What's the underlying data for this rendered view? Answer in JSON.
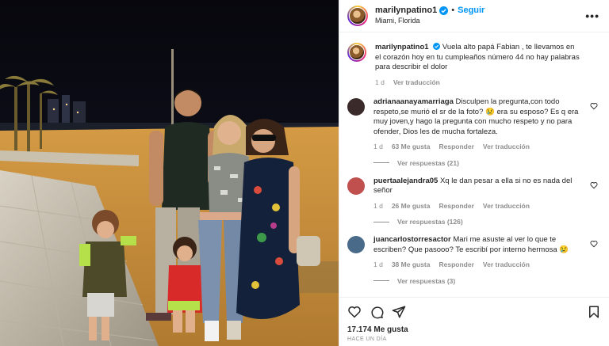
{
  "post": {
    "username": "marilynpatino1",
    "follow_label": "Seguir",
    "separator": "•",
    "location": "Miami, Florida",
    "more_icon": "more-options-icon",
    "caption": {
      "username": "marilynpatino1",
      "text": "Vuela alto papá Fabian , te llevamos en el corazón hoy en tu cumpleaños número 44 no hay palabras para describir el dolor",
      "time": "1 d",
      "translate": "Ver traducción"
    }
  },
  "comments": [
    {
      "username": "adrianaanayamarriaga",
      "text": "Disculpen la pregunta,con todo respeto,se murió el sr de la foto? 😢 era su esposo? Es q era muy joven,y hago la pregunta con mucho respeto y no para ofender, Dios les de mucha fortaleza.",
      "time": "1 d",
      "likes": "63 Me gusta",
      "reply": "Responder",
      "translate": "Ver traducción",
      "replies": "Ver respuestas (21)",
      "avatar_color": "#3b2a2a"
    },
    {
      "username": "puertaalejandra05",
      "text": "Xq le dan pesar a ella si no es nada del señor",
      "time": "1 d",
      "likes": "26 Me gusta",
      "reply": "Responder",
      "translate": "Ver traducción",
      "replies": "Ver respuestas (126)",
      "avatar_color": "#c0504d"
    },
    {
      "username": "juancarlostorresactor",
      "text": "Mari me asuste al ver lo que te escriben? Que pasooo? Te escribí por interno hermosa 😢",
      "time": "1 d",
      "likes": "38 Me gusta",
      "reply": "Responder",
      "translate": "Ver traducción",
      "replies": "Ver respuestas (3)",
      "avatar_color": "#4a6a8a"
    }
  ],
  "footer": {
    "likes": "17.174 Me gusta",
    "ago": "HACE UN DÍA",
    "icons": [
      "heart-icon",
      "comment-icon",
      "share-icon",
      "bookmark-icon"
    ]
  },
  "colors": {
    "accent": "#0095f6",
    "verified": "#0095f6",
    "secondary_text": "#8e8e8e"
  }
}
